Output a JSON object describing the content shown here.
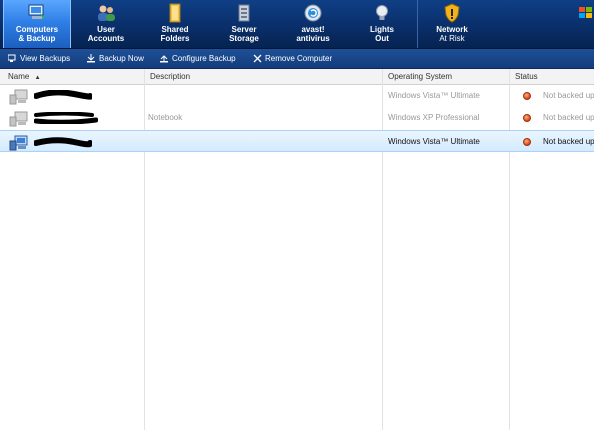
{
  "nav": {
    "tabs": [
      {
        "line1": "Computers",
        "line2": "& Backup",
        "icon": "computers-icon",
        "active": true
      },
      {
        "line1": "User",
        "line2": "Accounts",
        "icon": "users-icon",
        "active": false
      },
      {
        "line1": "Shared",
        "line2": "Folders",
        "icon": "folders-icon",
        "active": false
      },
      {
        "line1": "Server",
        "line2": "Storage",
        "icon": "storage-icon",
        "active": false
      },
      {
        "line1": "avast!",
        "line2": "antivirus",
        "icon": "antivirus-icon",
        "active": false
      },
      {
        "line1": "Lights",
        "line2": "Out",
        "icon": "lightbulb-icon",
        "active": false
      },
      {
        "line1": "Network",
        "line2": "At Risk",
        "icon": "shield-warning-icon",
        "active": false
      }
    ]
  },
  "toolbar": {
    "view_backups": "View Backups",
    "backup_now": "Backup Now",
    "configure_backup": "Configure Backup",
    "remove_computer": "Remove Computer"
  },
  "table": {
    "columns": {
      "name": "Name",
      "description": "Description",
      "os": "Operating System",
      "status": "Status"
    },
    "rows": [
      {
        "description": "",
        "os": "Windows Vista™ Ultimate",
        "status": "Not backed up",
        "selected": false
      },
      {
        "description": "Notebook",
        "os": "Windows XP Professional",
        "status": "Not backed up",
        "selected": false
      },
      {
        "description": "",
        "os": "Windows Vista™ Ultimate",
        "status": "Not backed up",
        "selected": true
      }
    ]
  },
  "colors": {
    "nav_bg": "#0a2f6a",
    "active_tab": "#2f7fe6",
    "selection": "#d4ebff",
    "status_error": "#d2461a"
  }
}
